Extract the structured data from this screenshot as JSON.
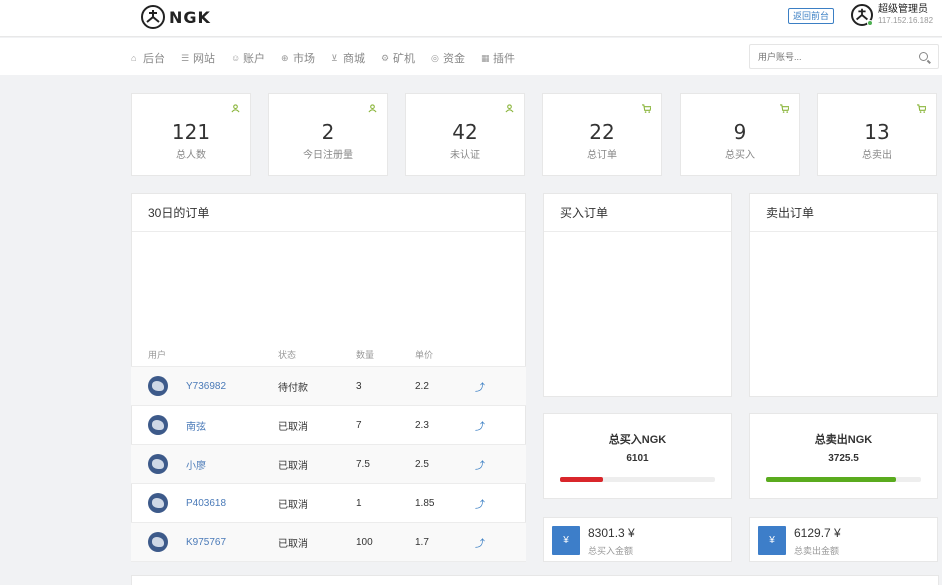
{
  "header": {
    "logo_text": "NGK",
    "back_button": "返回前台",
    "admin_name": "超级管理员",
    "admin_ip": "117.152.16.182"
  },
  "nav": {
    "items": [
      {
        "label": "后台",
        "icon": "home-icon"
      },
      {
        "label": "网站",
        "icon": "list-icon"
      },
      {
        "label": "账户",
        "icon": "users-icon"
      },
      {
        "label": "市场",
        "icon": "globe-icon"
      },
      {
        "label": "商城",
        "icon": "cart-icon"
      },
      {
        "label": "矿机",
        "icon": "gear-icon"
      },
      {
        "label": "资金",
        "icon": "coin-icon"
      },
      {
        "label": "插件",
        "icon": "grid-icon"
      }
    ],
    "search_placeholder": "用户账号..."
  },
  "stats": [
    {
      "value": "121",
      "label": "总人数",
      "icon": "user-icon"
    },
    {
      "value": "2",
      "label": "今日注册量",
      "icon": "user-icon"
    },
    {
      "value": "42",
      "label": "未认证",
      "icon": "user-icon"
    },
    {
      "value": "22",
      "label": "总订单",
      "icon": "cart-icon"
    },
    {
      "value": "9",
      "label": "总买入",
      "icon": "cart-icon"
    },
    {
      "value": "13",
      "label": "总卖出",
      "icon": "cart-icon"
    }
  ],
  "orders": {
    "title": "30日的订单",
    "columns": [
      "用户",
      "状态",
      "数量",
      "单价"
    ],
    "rows": [
      {
        "user": "Y736982",
        "status": "待付款",
        "qty": "3",
        "price": "2.2"
      },
      {
        "user": "南弦",
        "status": "已取消",
        "qty": "7",
        "price": "2.3"
      },
      {
        "user": "小廖",
        "status": "已取消",
        "qty": "7.5",
        "price": "2.5"
      },
      {
        "user": "P403618",
        "status": "已取消",
        "qty": "1",
        "price": "1.85"
      },
      {
        "user": "K975767",
        "status": "已取消",
        "qty": "100",
        "price": "1.7"
      }
    ]
  },
  "buy_panel": {
    "title": "买入订单"
  },
  "sell_panel": {
    "title": "卖出订单"
  },
  "totals": {
    "buy": {
      "title": "总买入NGK",
      "value": "6101",
      "bar_fraction": 0.28,
      "bar_color": "#d9262b"
    },
    "sell": {
      "title": "总卖出NGK",
      "value": "3725.5",
      "bar_fraction": 0.84,
      "bar_color": "#5aab1e"
    }
  },
  "amounts": {
    "buy": {
      "symbol": "¥",
      "value": "8301.3 ¥",
      "label": "总买入金额"
    },
    "sell": {
      "symbol": "¥",
      "value": "6129.7 ¥",
      "label": "总卖出金额"
    }
  },
  "colors": {
    "accent": "#3d7ec9",
    "icon_green": "#8ab53b"
  }
}
